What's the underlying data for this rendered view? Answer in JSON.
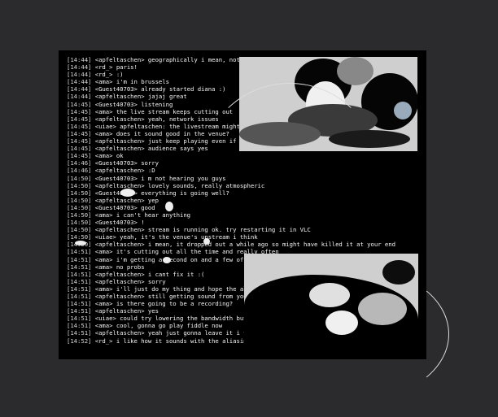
{
  "chat": {
    "lines": [
      {
        "ts": "[14:44]",
        "nick": "<apfeltaschen>",
        "msg": "geographically i mean, not musically :)"
      },
      {
        "ts": "[14:44]",
        "nick": "<rd_>",
        "msg": "paris!"
      },
      {
        "ts": "[14:44]",
        "nick": "<rd_>",
        "msg": ":)"
      },
      {
        "ts": "[14:44]",
        "nick": "<ama>",
        "msg": "i'm in brussels"
      },
      {
        "ts": "[14:44]",
        "nick": "<Guest40703>",
        "msg": "already started diana :)"
      },
      {
        "ts": "[14:44]",
        "nick": "<apfeltaschen>",
        "msg": "jajaj great"
      },
      {
        "ts": "[14:45]",
        "nick": "<Guest40703>",
        "msg": "listening"
      },
      {
        "ts": "[14:45]",
        "nick": "<ama>",
        "msg": "the live stream keeps cutting out"
      },
      {
        "ts": "[14:45]",
        "nick": "<apfeltaschen>",
        "msg": "yeah, network issues"
      },
      {
        "ts": "[14:45]",
        "nick": "<uiae>",
        "msg": "apfeltaschen: the livestream might be clipping"
      },
      {
        "ts": "[14:45]",
        "nick": "<ama>",
        "msg": "does it sound good in the venue?"
      },
      {
        "ts": "[14:45]",
        "nick": "<apfeltaschen>",
        "msg": "just keep playing even if sound drops"
      },
      {
        "ts": "[14:45]",
        "nick": "<apfeltaschen>",
        "msg": "audience says yes"
      },
      {
        "ts": "[14:45]",
        "nick": "<ama>",
        "msg": "ok"
      },
      {
        "ts": "[14:46]",
        "nick": "<Guest40703>",
        "msg": "sorry"
      },
      {
        "ts": "[14:46]",
        "nick": "<apfeltaschen>",
        "msg": ":D"
      },
      {
        "ts": "[14:50]",
        "nick": "<Guest40703>",
        "msg": "i m not hearing you guys"
      },
      {
        "ts": "[14:50]",
        "nick": "<apfeltaschen>",
        "msg": "lovely sounds, really atmospheric"
      },
      {
        "ts": "[14:50]",
        "nick": "<Guest40703>",
        "msg": "everything is going well?"
      },
      {
        "ts": "[14:50]",
        "nick": "<apfeltaschen>",
        "msg": "yep"
      },
      {
        "ts": "[14:50]",
        "nick": "<Guest40703>",
        "msg": "good"
      },
      {
        "ts": "[14:50]",
        "nick": "<ama>",
        "msg": "i can't hear anything"
      },
      {
        "ts": "[14:50]",
        "nick": "<Guest40703>",
        "msg": "!"
      },
      {
        "ts": "[14:50]",
        "nick": "<apfeltaschen>",
        "msg": "stream is running ok. try restarting it in VLC"
      },
      {
        "ts": "[14:50]",
        "nick": "<uiae>",
        "msg": "yeah, it's the venue's upstream i think"
      },
      {
        "ts": "[14:50]",
        "nick": "<apfeltaschen>",
        "msg": "i mean, it dropped out a while ago so might have killed it at your end"
      },
      {
        "ts": "[14:51]",
        "nick": "<ama>",
        "msg": "it's cutting out all the time and really often"
      },
      {
        "ts": "[14:51]",
        "nick": "<ama>",
        "msg": "i'm getting a second on and a few off and then"
      },
      {
        "ts": "[14:51]",
        "nick": "<ama>",
        "msg": "no probs"
      },
      {
        "ts": "[14:51]",
        "nick": "<apfeltaschen>",
        "msg": "i cant fix it :("
      },
      {
        "ts": "[14:51]",
        "nick": "<apfeltaschen>",
        "msg": "sorry"
      },
      {
        "ts": "[14:51]",
        "nick": "<ama>",
        "msg": "i'll just do my thing and hope the algo blends me"
      },
      {
        "ts": "[14:51]",
        "nick": "<apfeltaschen>",
        "msg": "still getting sound from you guys though :)"
      },
      {
        "ts": "[14:51]",
        "nick": "<ama>",
        "msg": "is there going to be a recording?"
      },
      {
        "ts": "[14:51]",
        "nick": "<apfeltaschen>",
        "msg": "yes"
      },
      {
        "ts": "[14:51]",
        "nick": "<uiae>",
        "msg": "could try lowering the bandwidth but maybe not a good idea mid-performance :)"
      },
      {
        "ts": "[14:51]",
        "nick": "<ama>",
        "msg": "cool, gonna go play fiddle now"
      },
      {
        "ts": "[14:51]",
        "nick": "<apfeltaschen>",
        "msg": "yeah just gonna leave it i think :)"
      },
      {
        "ts": "[14:52]",
        "nick": "<rd_>",
        "msg": "i like how it sounds with the aliasing from here"
      }
    ]
  }
}
